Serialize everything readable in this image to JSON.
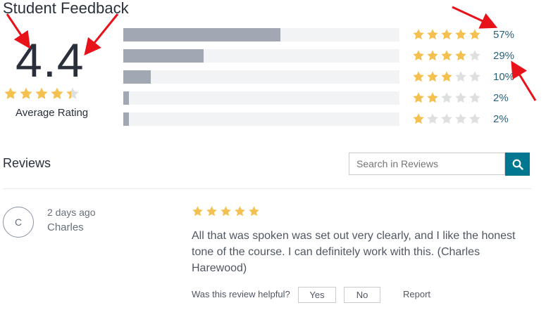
{
  "header": {
    "title": "Student Feedback"
  },
  "summary": {
    "rating": "4.4",
    "rating_value": 4.4,
    "label": "Average Rating"
  },
  "breakdown": [
    {
      "stars": 5,
      "fraction": 0.57,
      "percent": "57%"
    },
    {
      "stars": 4,
      "fraction": 0.29,
      "percent": "29%"
    },
    {
      "stars": 3,
      "fraction": 0.1,
      "percent": "10%"
    },
    {
      "stars": 2,
      "fraction": 0.02,
      "percent": "2%"
    },
    {
      "stars": 1,
      "fraction": 0.02,
      "percent": "2%"
    }
  ],
  "reviews": {
    "title": "Reviews",
    "search_placeholder": "Search in Reviews",
    "items": [
      {
        "avatar_initial": "C",
        "time": "2 days ago",
        "name": "Charles",
        "stars": 5,
        "text": "All that was spoken was set out very clearly, and I like the honest tone of the course. I can definitely work with this. (Charles Harewood)",
        "helpful_label": "Was this review helpful?",
        "yes_label": "Yes",
        "no_label": "No",
        "report_label": "Report"
      }
    ]
  },
  "icons": {
    "search": "search-icon",
    "star_filled": "star-filled-icon",
    "star_empty": "star-empty-icon",
    "annotation": "red-arrow-icon"
  },
  "colors": {
    "star_filled": "#f4c150",
    "star_empty": "#dedfe0",
    "bar_fill": "#a1a7b3",
    "bar_track": "#f2f3f5",
    "percent_link": "#29617b",
    "accent": "#007791",
    "annotation_arrow": "#e8121b"
  }
}
